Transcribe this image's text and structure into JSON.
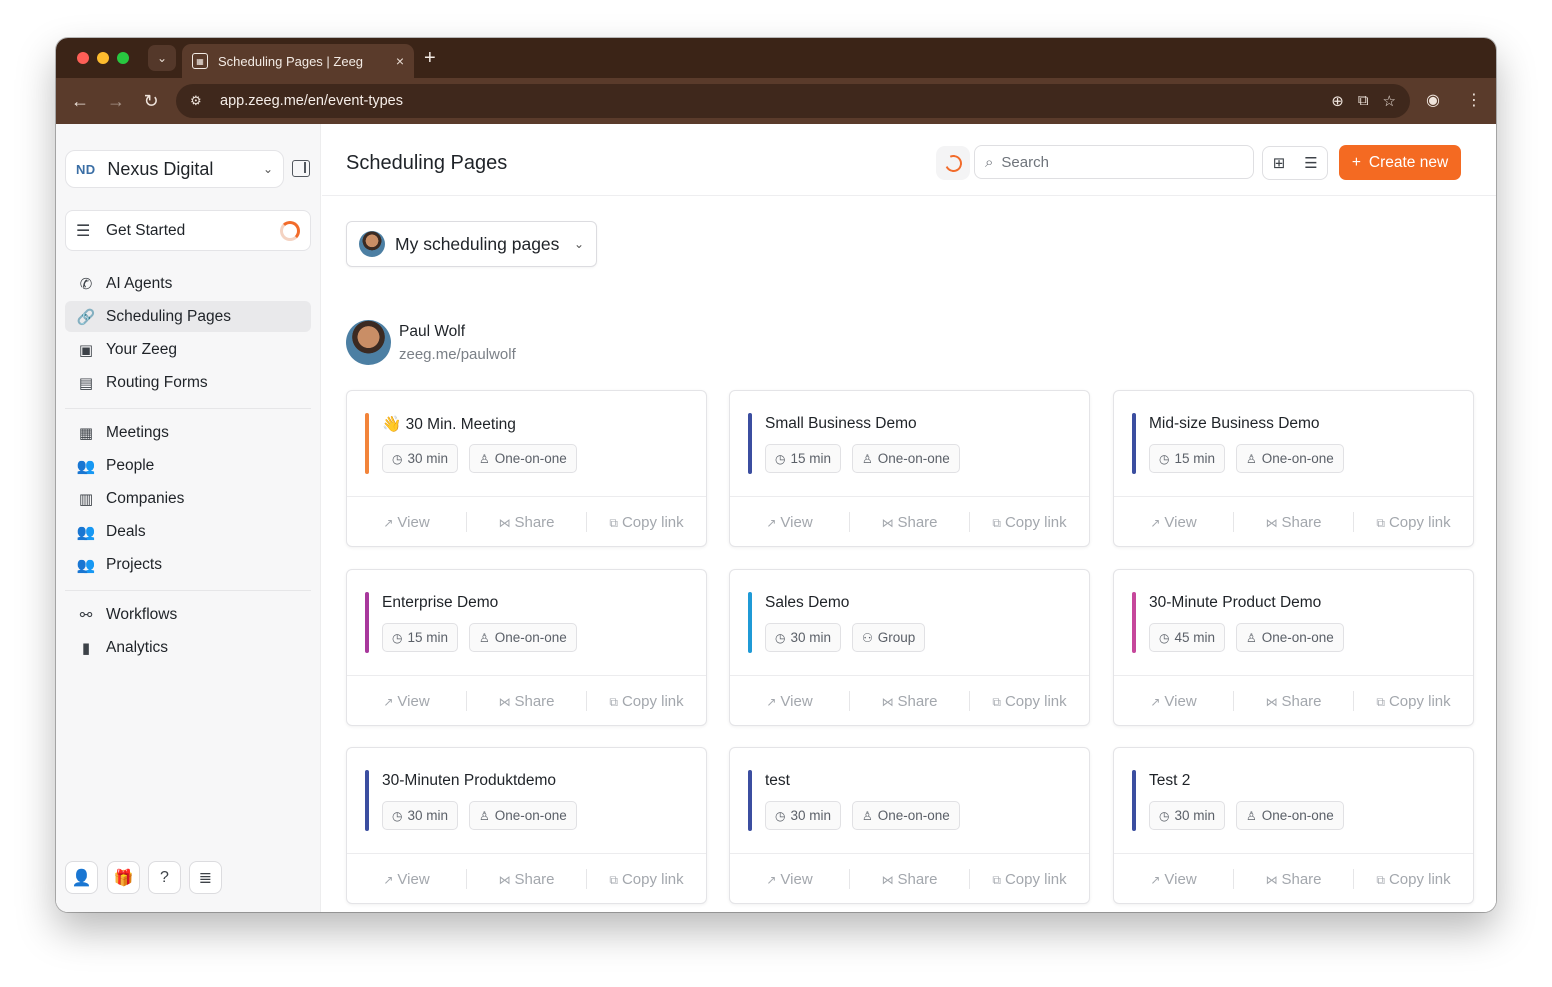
{
  "browser": {
    "tab_title": "Scheduling Pages | Zeeg",
    "url": "app.zeeg.me/en/event-types",
    "tab_close": "×",
    "new_tab": "+"
  },
  "sidebar": {
    "workspace_initials": "ND",
    "workspace_name": "Nexus Digital",
    "get_started": "Get Started",
    "nav_group_1": [
      {
        "label": "AI Agents",
        "icon": "phone-sparkle-icon"
      },
      {
        "label": "Scheduling Pages",
        "icon": "link-icon",
        "active": true
      },
      {
        "label": "Your Zeeg",
        "icon": "profile-card-icon"
      },
      {
        "label": "Routing Forms",
        "icon": "document-icon"
      }
    ],
    "nav_group_2": [
      {
        "label": "Meetings",
        "icon": "calendar-icon"
      },
      {
        "label": "People",
        "icon": "people-icon"
      },
      {
        "label": "Companies",
        "icon": "building-icon"
      },
      {
        "label": "Deals",
        "icon": "people-icon"
      },
      {
        "label": "Projects",
        "icon": "people-icon"
      }
    ],
    "nav_group_3": [
      {
        "label": "Workflows",
        "icon": "workflow-icon"
      },
      {
        "label": "Analytics",
        "icon": "bar-chart-icon"
      }
    ]
  },
  "header": {
    "title": "Scheduling Pages",
    "search_placeholder": "Search",
    "create_label": "Create new"
  },
  "filter": {
    "label": "My scheduling pages"
  },
  "owner": {
    "name": "Paul Wolf",
    "link": "zeeg.me/paulwolf"
  },
  "actions": {
    "view": "View",
    "share": "Share",
    "copy": "Copy link"
  },
  "cards": [
    {
      "title": "👋 30 Min. Meeting",
      "duration": "30 min",
      "type": "One-on-one",
      "accent": "#f2843a"
    },
    {
      "title": "Small Business Demo",
      "duration": "15 min",
      "type": "One-on-one",
      "accent": "#3b4ea0"
    },
    {
      "title": "Mid-size Business Demo",
      "duration": "15 min",
      "type": "One-on-one",
      "accent": "#3b4ea0"
    },
    {
      "title": "Enterprise Demo",
      "duration": "15 min",
      "type": "One-on-one",
      "accent": "#a8389c"
    },
    {
      "title": "Sales Demo",
      "duration": "30 min",
      "type": "Group",
      "accent": "#1f9ad6"
    },
    {
      "title": "30-Minute Product Demo",
      "duration": "45 min",
      "type": "One-on-one",
      "accent": "#c6479b"
    },
    {
      "title": "30-Minuten Produktdemo",
      "duration": "30 min",
      "type": "One-on-one",
      "accent": "#3b4ea0"
    },
    {
      "title": "test",
      "duration": "30 min",
      "type": "One-on-one",
      "accent": "#3b4ea0"
    },
    {
      "title": "Test 2",
      "duration": "30 min",
      "type": "One-on-one",
      "accent": "#3b4ea0"
    }
  ],
  "colors": {
    "brand_orange": "#f46a22",
    "browser_chrome": "#5a3b2b"
  }
}
